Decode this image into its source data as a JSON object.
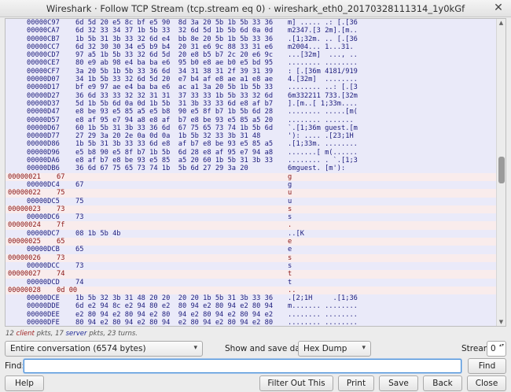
{
  "window": {
    "title": "Wireshark · Follow TCP Stream (tcp.stream eq 0) · wireshark_eth0_20170328111314_1y0kGf",
    "close_glyph": "✕"
  },
  "stream_lines": [
    {
      "dir": "server",
      "offset": "00000C97",
      "hex": "6d 5d 20 e5 8c bf e5 90  8d 3a 20 5b 1b 5b 33 36",
      "ascii": "m] ..... .: [.[36"
    },
    {
      "dir": "server",
      "offset": "00000CA7",
      "hex": "6d 32 33 34 37 1b 5b 33  32 6d 5d 1b 5b 6d 0a 0d",
      "ascii": "m2347.[3 2m].[m.."
    },
    {
      "dir": "server",
      "offset": "00000CB7",
      "hex": "1b 5b 31 3b 33 32 6d e4  bb 8e 20 5b 1b 5b 33 36",
      "ascii": ".[1;32m. .. [.[36"
    },
    {
      "dir": "server",
      "offset": "00000CC7",
      "hex": "6d 32 30 30 34 e5 b9 b4  20 31 e6 9c 88 33 31 e6",
      "ascii": "m2004... 1...31."
    },
    {
      "dir": "server",
      "offset": "00000CD7",
      "hex": "97 a5 1b 5b 33 32 6d 5d  20 e8 b5 b7 2c 20 e6 9c",
      "ascii": "...[32m]  ..., .."
    },
    {
      "dir": "server",
      "offset": "00000CE7",
      "hex": "80 e9 ab 98 e4 ba ba e6  95 b0 e8 ae b0 e5 bd 95",
      "ascii": "........ ........"
    },
    {
      "dir": "server",
      "offset": "00000CF7",
      "hex": "3a 20 5b 1b 5b 33 36 6d  34 31 38 31 2f 39 31 39",
      "ascii": ": [.[36m 4181/919"
    },
    {
      "dir": "server",
      "offset": "00000D07",
      "hex": "34 1b 5b 33 32 6d 5d 20  e7 b4 af e8 ae a1 e8 ae",
      "ascii": "4.[32m]  ........"
    },
    {
      "dir": "server",
      "offset": "00000D17",
      "hex": "bf e9 97 ae e4 ba ba e6  ac a1 3a 20 5b 1b 5b 33",
      "ascii": "........ ..: [.[3"
    },
    {
      "dir": "server",
      "offset": "00000D27",
      "hex": "36 6d 33 33 32 32 31 31  37 33 33 1b 5b 33 32 6d",
      "ascii": "6m332211 733.[32m"
    },
    {
      "dir": "server",
      "offset": "00000D37",
      "hex": "5d 1b 5b 6d 0a 0d 1b 5b  31 3b 33 33 6d e8 af b7",
      "ascii": "].[m..[ 1;33m...."
    },
    {
      "dir": "server",
      "offset": "00000D47",
      "hex": "e8 be 93 e5 85 a5 e5 b8  90 e5 8f b7 1b 5b 6d 28",
      "ascii": "........ .....[m("
    },
    {
      "dir": "server",
      "offset": "00000D57",
      "hex": "e8 af 95 e7 94 a8 e8 af  b7 e8 be 93 e5 85 a5 20",
      "ascii": "........ ....... "
    },
    {
      "dir": "server",
      "offset": "00000D67",
      "hex": "60 1b 5b 31 3b 33 36 6d  67 75 65 73 74 1b 5b 6d",
      "ascii": "`.[1;36m guest.[m"
    },
    {
      "dir": "server",
      "offset": "00000D77",
      "hex": "27 29 3a 20 2e 0a 0d 0a  1b 5b 32 33 3b 31 48",
      "ascii": "'): .... .[23;1H"
    },
    {
      "dir": "server",
      "offset": "00000D86",
      "hex": "1b 5b 31 3b 33 33 6d e8  af b7 e8 be 93 e5 85 a5",
      "ascii": ".[1;33m. ........"
    },
    {
      "dir": "server",
      "offset": "00000D96",
      "hex": "e5 b8 90 e5 8f b7 1b 5b  6d 28 e8 af 95 e7 94 a8",
      "ascii": ".......[ m(......"
    },
    {
      "dir": "server",
      "offset": "00000DA6",
      "hex": "e8 af b7 e8 be 93 e5 85  a5 20 60 1b 5b 31 3b 33",
      "ascii": "........ . `.[1;3"
    },
    {
      "dir": "server",
      "offset": "00000DB6",
      "hex": "36 6d 67 75 65 73 74 1b  5b 6d 27 29 3a 20",
      "ascii": "6mguest. [m'): "
    },
    {
      "dir": "client",
      "offset": "00000021",
      "hex": "67",
      "ascii": "g"
    },
    {
      "dir": "server",
      "offset": "00000DC4",
      "hex": "67",
      "ascii": "g"
    },
    {
      "dir": "client",
      "offset": "00000022",
      "hex": "75",
      "ascii": "u"
    },
    {
      "dir": "server",
      "offset": "00000DC5",
      "hex": "75",
      "ascii": "u"
    },
    {
      "dir": "client",
      "offset": "00000023",
      "hex": "73",
      "ascii": "s"
    },
    {
      "dir": "server",
      "offset": "00000DC6",
      "hex": "73",
      "ascii": "s"
    },
    {
      "dir": "client",
      "offset": "00000024",
      "hex": "7f",
      "ascii": "."
    },
    {
      "dir": "server",
      "offset": "00000DC7",
      "hex": "08 1b 5b 4b",
      "ascii": "..[K"
    },
    {
      "dir": "client",
      "offset": "00000025",
      "hex": "65",
      "ascii": "e"
    },
    {
      "dir": "server",
      "offset": "00000DCB",
      "hex": "65",
      "ascii": "e"
    },
    {
      "dir": "client",
      "offset": "00000026",
      "hex": "73",
      "ascii": "s"
    },
    {
      "dir": "server",
      "offset": "00000DCC",
      "hex": "73",
      "ascii": "s"
    },
    {
      "dir": "client",
      "offset": "00000027",
      "hex": "74",
      "ascii": "t"
    },
    {
      "dir": "server",
      "offset": "00000DCD",
      "hex": "74",
      "ascii": "t"
    },
    {
      "dir": "client",
      "offset": "00000028",
      "hex": "0d 00",
      "ascii": ".."
    },
    {
      "dir": "server",
      "offset": "00000DCE",
      "hex": "1b 5b 32 3b 31 48 20 20  20 20 1b 5b 31 3b 33 36",
      "ascii": ".[2;1H     .[1;36"
    },
    {
      "dir": "server",
      "offset": "00000DDE",
      "hex": "6d e2 94 8c e2 94 80 e2  80 94 e2 80 94 e2 80 94",
      "ascii": "m....... ........"
    },
    {
      "dir": "server",
      "offset": "00000DEE",
      "hex": "e2 80 94 e2 80 94 e2 80  94 e2 80 94 e2 80 94 e2",
      "ascii": "........ ........"
    },
    {
      "dir": "server",
      "offset": "00000DFE",
      "hex": "80 94 e2 80 94 e2 80 94  e2 80 94 e2 80 94 e2 80",
      "ascii": "........ ........"
    }
  ],
  "summary": {
    "client_count": "12",
    "client_word": "client",
    "middle": "pkts, 17",
    "server_word": "server",
    "tail": "pkts, 23 turns."
  },
  "controls": {
    "conversation_select": "Entire conversation (6574 bytes)",
    "show_label": "Show and save data as",
    "format_select": "Hex Dump",
    "stream_label": "Stream",
    "stream_value": "0",
    "find_label": "Find:",
    "find_value": "",
    "find_next": "Find Next"
  },
  "buttons": {
    "help": "Help",
    "filter_out": "Filter Out This Stream",
    "print": "Print",
    "save_as": "Save as...",
    "back": "Back",
    "close": "Close"
  },
  "icons": {
    "caret": "▾",
    "scroll_up": "▲",
    "scroll_down": "▼",
    "spin": "▴▾"
  },
  "colors": {
    "server_bg": "#eaeaf9",
    "server_fg": "#1c1c7c",
    "client_bg": "#f9ecec",
    "client_fg": "#8a1616"
  },
  "scroll_position": 0.49
}
